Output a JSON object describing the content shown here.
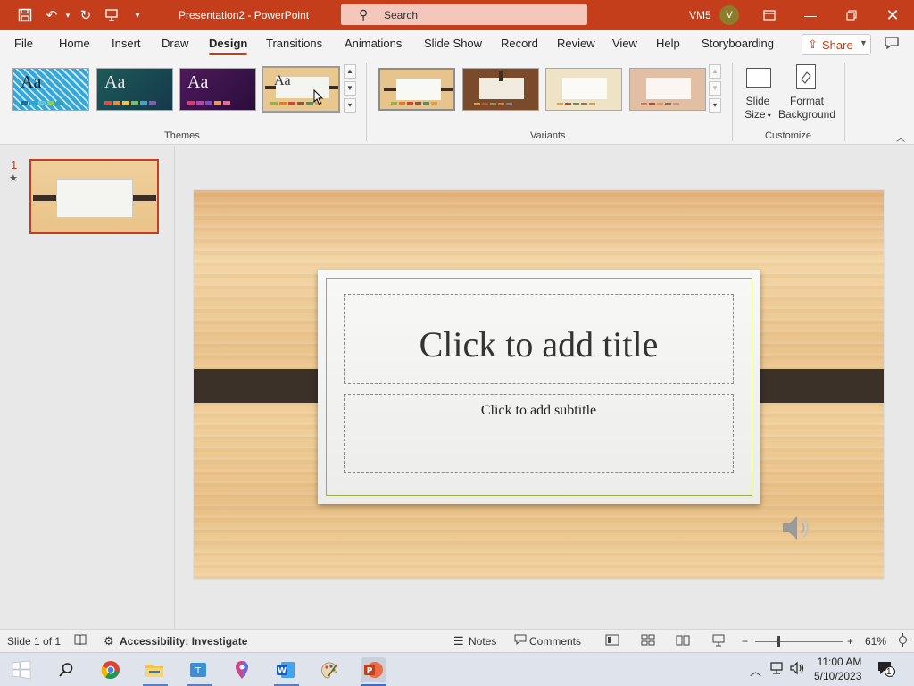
{
  "app": {
    "doc_title": "Presentation2  -  PowerPoint",
    "search_placeholder": "Search",
    "user_initials": "VM5",
    "avatar_letter": "V"
  },
  "tabs": [
    "File",
    "Home",
    "Insert",
    "Draw",
    "Design",
    "Transitions",
    "Animations",
    "Slide Show",
    "Record",
    "Review",
    "View",
    "Help",
    "Storyboarding"
  ],
  "active_tab": "Design",
  "share_label": "Share",
  "ribbon": {
    "themes": [
      {
        "name": "theme-1",
        "aa": "Aa"
      },
      {
        "name": "theme-2",
        "aa": "Aa"
      },
      {
        "name": "theme-3",
        "aa": "Aa"
      },
      {
        "name": "theme-4",
        "aa": "Aa"
      }
    ],
    "themes_label": "Themes",
    "variants_label": "Variants",
    "customize_label": "Customize",
    "slide_size_line1": "Slide",
    "slide_size_line2": "Size",
    "format_bg_line1": "Format",
    "format_bg_line2": "Background"
  },
  "thumbnails": {
    "slide_number": "1",
    "star": "★"
  },
  "slide": {
    "title_placeholder": "Click to add title",
    "subtitle_placeholder": "Click to add subtitle"
  },
  "status": {
    "slide_info": "Slide 1 of 1",
    "accessibility": "Accessibility: Investigate",
    "notes": "Notes",
    "comments": "Comments",
    "zoom_minus": "−",
    "zoom_plus": "+",
    "zoom": "61%",
    "zoom_fraction": 0.27
  },
  "taskbar": {
    "time": "11:00 AM",
    "date": "5/10/2023",
    "notification_count": "1"
  },
  "colors": {
    "accent": "#c43e1c",
    "strap": "#3b3129",
    "wood": "#eac38c",
    "frame_green": "#9cae4a"
  }
}
